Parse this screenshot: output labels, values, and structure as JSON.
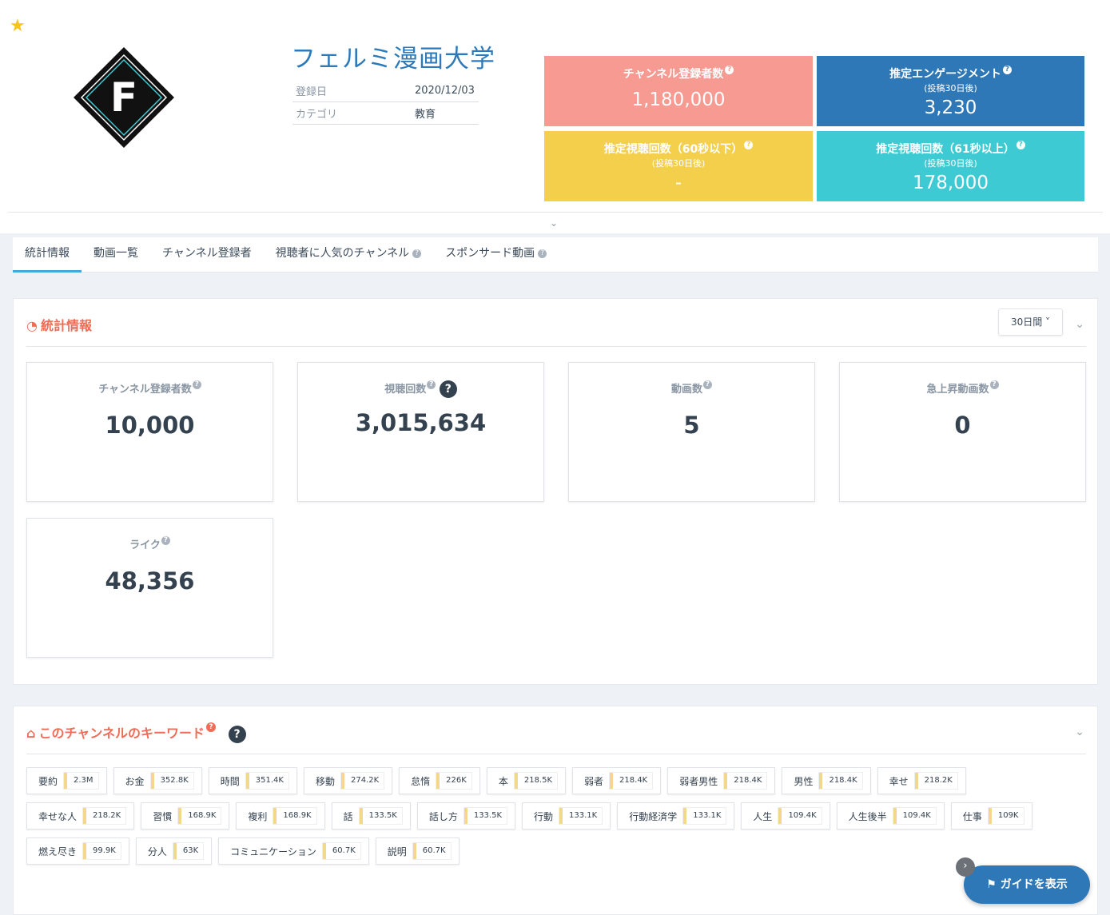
{
  "channel": {
    "name": "フェルミ漫画大学",
    "logo_letter": "F",
    "meta": [
      {
        "key": "登録日",
        "value": "2020/12/03"
      },
      {
        "key": "カテゴリ",
        "value": "教育"
      }
    ]
  },
  "kpis": [
    {
      "title": "チャンネル登録者数",
      "sub": "",
      "value": "1,180,000"
    },
    {
      "title": "推定エンゲージメント",
      "sub": "(投稿30日後)",
      "value": "3,230"
    },
    {
      "title": "推定視聴回数（60秒以下）",
      "sub": "(投稿30日後)",
      "value": "-"
    },
    {
      "title": "推定視聴回数（61秒以上）",
      "sub": "(投稿30日後)",
      "value": "178,000"
    }
  ],
  "tabs": [
    "統計情報",
    "動画一覧",
    "チャンネル登録者",
    "視聴者に人気のチャンネル",
    "スポンサード動画"
  ],
  "stats_panel": {
    "title": "統計情報",
    "period": "30日間",
    "cards": [
      {
        "label": "チャンネル登録者数",
        "value": "10,000"
      },
      {
        "label": "視聴回数",
        "value": "3,015,634"
      },
      {
        "label": "動画数",
        "value": "5"
      },
      {
        "label": "急上昇動画数",
        "value": "0"
      },
      {
        "label": "ライク",
        "value": "48,356"
      }
    ]
  },
  "keywords_panel": {
    "title": "このチャンネルのキーワード",
    "keywords": [
      {
        "word": "要約",
        "count": "2.3M"
      },
      {
        "word": "お金",
        "count": "352.8K"
      },
      {
        "word": "時間",
        "count": "351.4K"
      },
      {
        "word": "移動",
        "count": "274.2K"
      },
      {
        "word": "怠惰",
        "count": "226K"
      },
      {
        "word": "本",
        "count": "218.5K"
      },
      {
        "word": "弱者",
        "count": "218.4K"
      },
      {
        "word": "弱者男性",
        "count": "218.4K"
      },
      {
        "word": "男性",
        "count": "218.4K"
      },
      {
        "word": "幸せ",
        "count": "218.2K"
      },
      {
        "word": "幸せな人",
        "count": "218.2K"
      },
      {
        "word": "習慣",
        "count": "168.9K"
      },
      {
        "word": "複利",
        "count": "168.9K"
      },
      {
        "word": "話",
        "count": "133.5K"
      },
      {
        "word": "話し方",
        "count": "133.5K"
      },
      {
        "word": "行動",
        "count": "133.1K"
      },
      {
        "word": "行動経済学",
        "count": "133.1K"
      },
      {
        "word": "人生",
        "count": "109.4K"
      },
      {
        "word": "人生後半",
        "count": "109.4K"
      },
      {
        "word": "仕事",
        "count": "109K"
      },
      {
        "word": "燃え尽き",
        "count": "99.9K"
      },
      {
        "word": "分人",
        "count": "63K"
      },
      {
        "word": "コミュニケーション",
        "count": "60.7K"
      },
      {
        "word": "説明",
        "count": "60.7K"
      }
    ]
  },
  "guide_button": "ガイドを表示",
  "colors": {
    "kpi1": "#f79a91",
    "kpi2": "#2f78b7",
    "kpi3": "#f3cf4b",
    "kpi4": "#3ecad3",
    "accent": "#f06c57"
  }
}
